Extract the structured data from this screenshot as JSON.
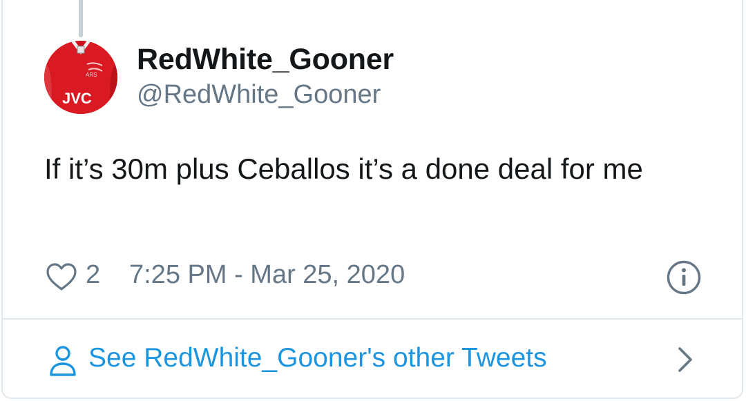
{
  "tweet": {
    "display_name": "RedWhite_Gooner",
    "handle": "@RedWhite_Gooner",
    "text": "If it’s 30m plus Ceballos it’s a done deal for me",
    "like_count": "2",
    "timestamp": "7:25 PM - Mar 25, 2020",
    "avatar": {
      "icon": "jersey-avatar",
      "jersey_text": "JVC",
      "colors": {
        "red": "#d2141c",
        "white": "#ffffff"
      }
    }
  },
  "footer": {
    "label": "See RedWhite_Gooner's other Tweets",
    "icons": [
      "person-icon",
      "chevron-right-icon"
    ]
  },
  "icons": [
    "heart-icon",
    "info-icon"
  ],
  "colors": {
    "text_primary": "#14171a",
    "text_secondary": "#657786",
    "link": "#1b95e0",
    "border": "#e1e8ed",
    "thread_line": "#c4cfd6"
  }
}
